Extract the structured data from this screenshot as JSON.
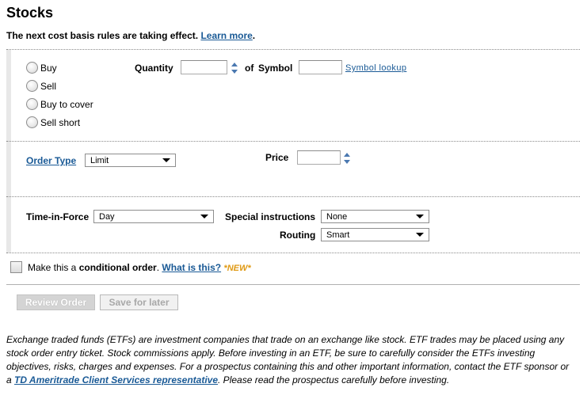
{
  "page_title": "Stocks",
  "notice": {
    "text": "The next cost basis rules are taking effect.",
    "link": "Learn more",
    "trailing": "."
  },
  "action": {
    "options": [
      "Buy",
      "Sell",
      "Buy to cover",
      "Sell short"
    ]
  },
  "quantity": {
    "label": "Quantity",
    "value": ""
  },
  "of_text": "of",
  "symbol": {
    "label": "Symbol",
    "value": "",
    "lookup_link": "Symbol lookup"
  },
  "order_type": {
    "label": "Order Type",
    "selected": "Limit"
  },
  "price": {
    "label": "Price",
    "value": ""
  },
  "time_in_force": {
    "label": "Time-in-Force",
    "selected": "Day"
  },
  "special_instructions": {
    "label": "Special instructions",
    "selected": "None"
  },
  "routing": {
    "label": "Routing",
    "selected": "Smart"
  },
  "conditional": {
    "prefix": "Make this a ",
    "bold": "conditional order",
    "suffix": ".",
    "link": "What is this?",
    "badge": "*NEW*",
    "checked": false
  },
  "buttons": {
    "review": "Review Order",
    "save": "Save for later"
  },
  "disclaimer": {
    "text_before": "Exchange traded funds (ETFs) are investment companies that trade on an exchange like stock. ETF trades may be placed using any stock order entry ticket. Stock commissions apply. Before investing in an ETF, be sure to carefully consider the ETFs investing objectives, risks, charges and expenses. For a prospectus containing this and other important information, contact the ETF sponsor or a ",
    "link": "TD Ameritrade Client Services representative",
    "text_after": ". Please read the prospectus carefully before investing."
  },
  "colors": {
    "link": "#1a5a96",
    "new_badge": "#e09a14",
    "panel_bar": "#e8e8e8"
  }
}
